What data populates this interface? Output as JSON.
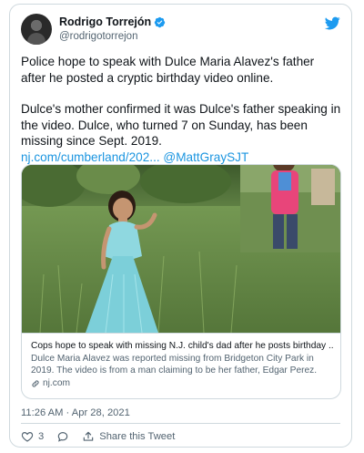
{
  "author": {
    "display_name": "Rodrigo Torrejón",
    "handle": "@rodrigotorrejon"
  },
  "tweet": {
    "paragraph1": "Police hope to speak with Dulce Maria Alavez's father after he posted a cryptic birthday video online.",
    "paragraph2": "Dulce's mother confirmed it was Dulce's father speaking in the video. Dulce, who turned 7 on Sunday, has been missing since Sept. 2019.",
    "link_text": "nj.com/cumberland/202...",
    "mention": "@MattGraySJT"
  },
  "link_card": {
    "title": "Cops hope to speak with missing N.J. child's dad after he posts birthday ...",
    "description": "Dulce Maria Alavez was reported missing from Bridgeton City Park in 2019. The video is from a man claiming to be her father, Edgar Perez.",
    "domain": "nj.com"
  },
  "timestamp": "11:26 AM · Apr 28, 2021",
  "actions": {
    "like_count": "3",
    "share_label": "Share this Tweet"
  },
  "colors": {
    "link": "#1b95e0",
    "twitter_blue": "#1d9bf0",
    "secondary_text": "#536471",
    "border": "#cfd9de",
    "like_red": "#f91880"
  },
  "icons": [
    "verified-badge-icon",
    "twitter-bird-icon",
    "link-icon",
    "heart-icon",
    "reply-icon",
    "share-icon"
  ]
}
